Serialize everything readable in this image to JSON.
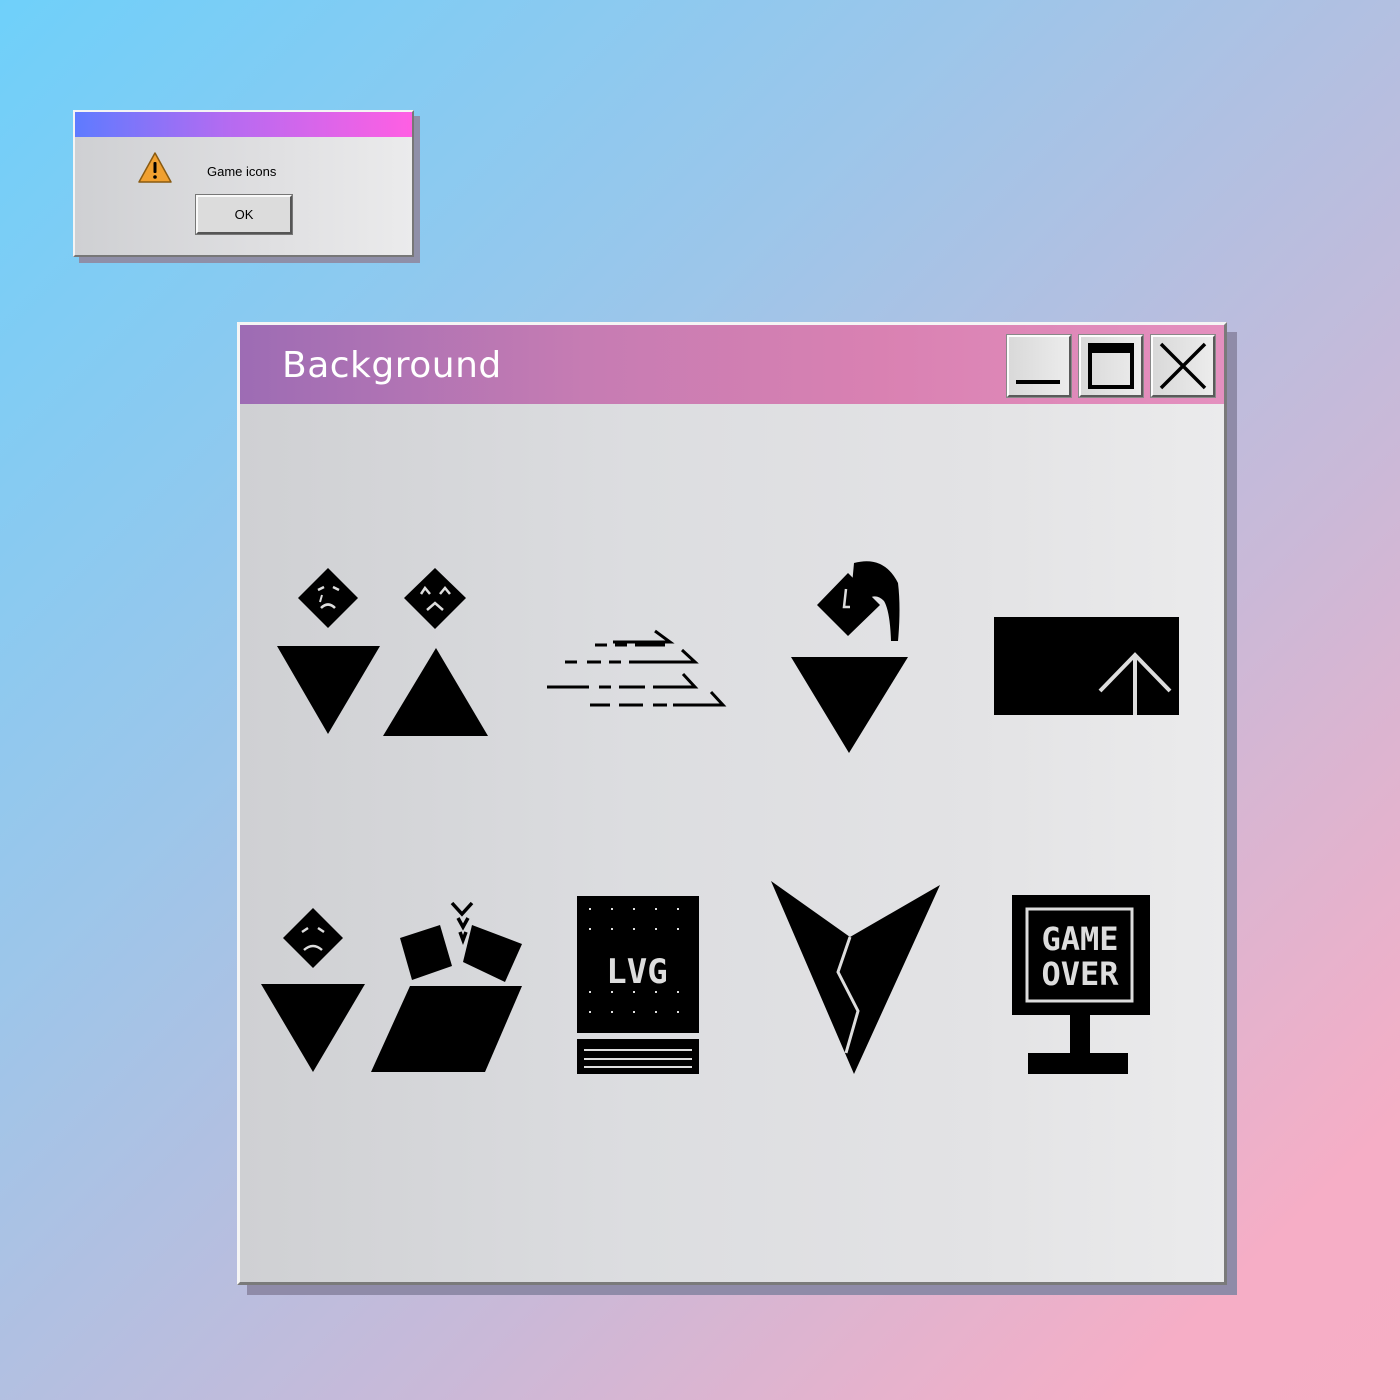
{
  "dialog": {
    "message": "Game icons",
    "ok_label": "OK",
    "icon": "warning-icon",
    "icon_color": "#f0a030"
  },
  "window": {
    "title": "Background",
    "controls": [
      "minimize-icon",
      "maximize-icon",
      "close-icon"
    ],
    "icons": [
      "sad-faces-triangles-icon",
      "speed-lines-icon",
      "defeated-diamond-triangle-icon",
      "level-up-panel-icon",
      "sad-face-broken-blocks-icon",
      "arcade-cabinet-icon",
      "broken-heart-chevron-icon",
      "game-over-sign-icon"
    ],
    "sign_text": [
      "GAME",
      "OVER"
    ],
    "cabinet_text": "LVG"
  },
  "colors": {
    "dialog_title_gradient": [
      "#5e7bff",
      "#ff5fe3"
    ],
    "window_title_gradient": [
      "#9d6cb4",
      "#e490bf"
    ],
    "icon_color": "#000000"
  }
}
